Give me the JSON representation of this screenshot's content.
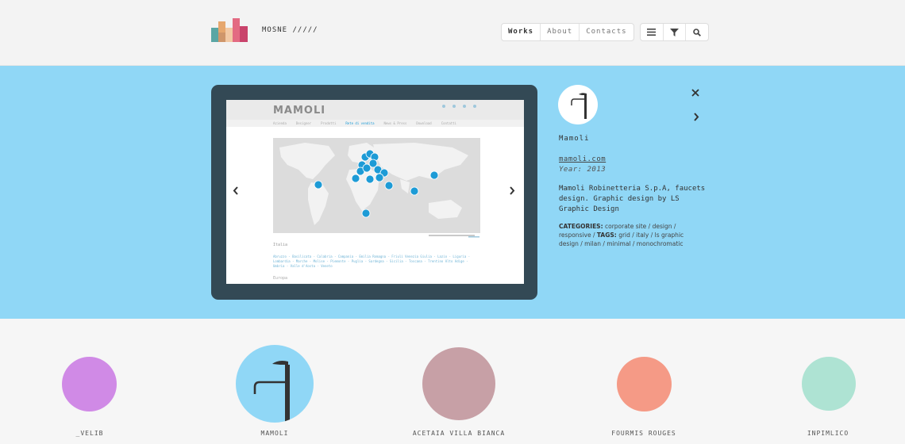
{
  "brand": {
    "name": "MOSNE /////"
  },
  "nav": {
    "items": [
      {
        "label": "Works",
        "active": true
      },
      {
        "label": "About",
        "active": false
      },
      {
        "label": "Contacts",
        "active": false
      }
    ]
  },
  "tools": [
    "menu-icon",
    "filter-icon",
    "search-icon"
  ],
  "feature": {
    "site_logo": "MAMOLI",
    "site_menu": [
      "Azienda",
      "Designer",
      "Prodotti",
      "Rete di vendita",
      "News & Press",
      "Download",
      "Contatti"
    ],
    "site_menu_active_index": 3,
    "site_heading": "Italia",
    "site_links": "Abruzzo - Basilicata - Calabria - Campania - Emilia Romagna - Friuli Venezia Giulia - Lazio - Liguria - Lombardia - Marche - Molise - Piemonte - Puglia - Sardegna - Sicilia - Toscana - Trentino Alto Adige - Umbria - Valle d'Aosta - Veneto",
    "site_footer": "Europa",
    "name": "Mamoli",
    "link": "mamoli.com",
    "year": "Year: 2013",
    "description": "Mamoli Robinetteria S.p.A, faucets design. Graphic design by LS Graphic Design",
    "categories_label": "CATEGORIES:",
    "categories": "corporate site / design / responsive /",
    "tags_label": "TAGS:",
    "tags": "grid / italy / ls graphic design / milan / minimal / monochromatic",
    "colors": {
      "band": "#90d7f6",
      "tablet": "#334955",
      "accent": "#1d9bd6"
    }
  },
  "gallery": [
    {
      "label": "_VELIB",
      "color": "#d08ae6"
    },
    {
      "label": "MAMOLI",
      "color": "#90d7f6"
    },
    {
      "label": "ACETAIA VILLA BIANCA",
      "color": "#c7a0a6"
    },
    {
      "label": "FOURMIS ROUGES",
      "color": "#f59a86"
    },
    {
      "label": "INPIMLICO",
      "color": "#aee3d3"
    }
  ]
}
